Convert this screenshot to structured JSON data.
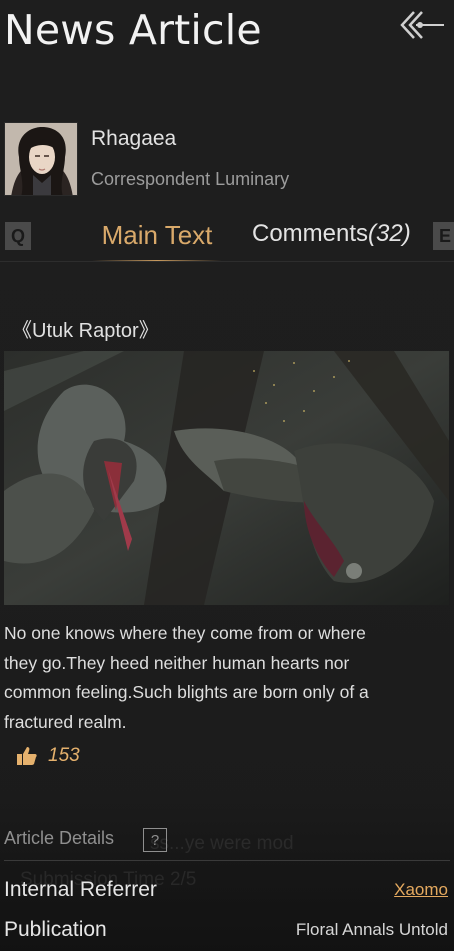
{
  "header": {
    "title": "News Article",
    "back_icon": "back-arrow-icon"
  },
  "author": {
    "name": "Rhagaea",
    "role": "Correspondent Luminary",
    "avatar_icon": "avatar-portrait"
  },
  "tabs": {
    "prev_key": "Q",
    "next_key": "E",
    "main_label": "Main Text",
    "comments_label": "Comments",
    "comments_count": "(32)"
  },
  "article": {
    "heading": "《Utuk Raptor》",
    "image_icon": "creature-illustration",
    "body": "No one knows where they come from or where they go.They heed neither human hearts nor common feeling.Such blights are born only of a fractured realm.",
    "likes": "153",
    "like_icon": "thumbs-up-icon"
  },
  "details": {
    "title": "Article Details",
    "help_label": "?",
    "ghost_line_1": "ss...ye  were mod",
    "ghost_line_2": "Submission Time  2/5",
    "rows": [
      {
        "label": "Internal Referrer",
        "value": "Xaomo"
      },
      {
        "label": "Publication",
        "value": "Floral Annals Untold"
      }
    ]
  },
  "colors": {
    "accent_gold": "#d9a96a",
    "link_orange": "#e4a95f",
    "background": "#1c1c1c"
  }
}
